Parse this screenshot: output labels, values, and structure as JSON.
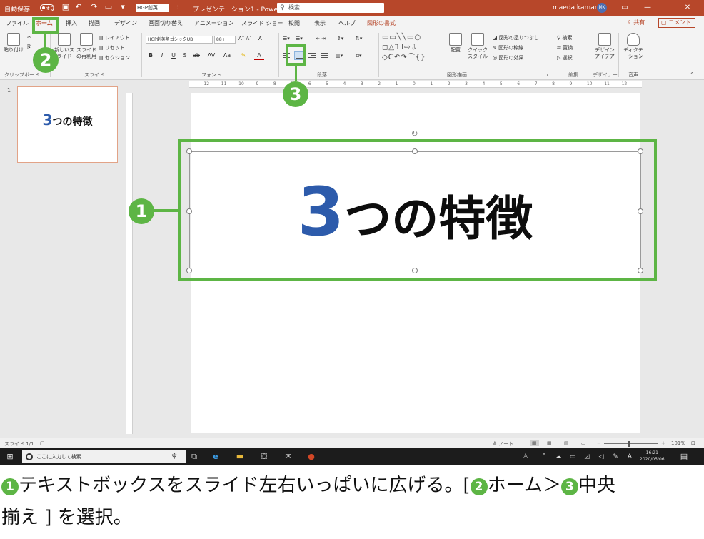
{
  "titlebar": {
    "autosave": "自動保存",
    "autosave_state": "オフ",
    "font_chip": "HGP創英",
    "doc_title": "プレゼンテーション1 - PowerPoint",
    "search_placeholder": "検索",
    "user_name": "maeda kamari",
    "user_initials": "MK"
  },
  "tabs": [
    "ファイル",
    "ホーム",
    "挿入",
    "描画",
    "デザイン",
    "画面切り替え",
    "アニメーション",
    "スライド ショー",
    "校閲",
    "表示",
    "ヘルプ",
    "図形の書式"
  ],
  "share_label": "共有",
  "comment_label": "コメント",
  "ribbon": {
    "clipboard_label": "クリップボード",
    "paste_label": "貼り付け",
    "slide_group_label": "スライド",
    "new_slide_label": "新しいスライド",
    "reuse_slide_label": "スライドの再利用",
    "layout_label": "レイアウト",
    "reset_label": "リセット",
    "section_label": "セクション",
    "font_group_label": "フォント",
    "font_name": "HGP創英角ゴシックUB",
    "font_size": "88+",
    "paragraph_label": "段落",
    "drawing_label": "図形描画",
    "arrange_label": "配置",
    "quick_style_label": "クイック スタイル",
    "shape_fill_label": "図形の塗りつぶし",
    "shape_outline_label": "図形の枠線",
    "shape_effect_label": "図形の効果",
    "editing_label": "編集",
    "find_label": "検索",
    "replace_label": "置換",
    "select_label": "選択",
    "designer_label": "デザイナー",
    "design_ideas_label": "デザイン アイデア",
    "voice_label": "音声",
    "dictate_label": "ディクテーション"
  },
  "ruler_numbers": [
    "12",
    "11",
    "10",
    "9",
    "8",
    "7",
    "6",
    "5",
    "4",
    "3",
    "2",
    "1",
    "0",
    "1",
    "2",
    "3",
    "4",
    "5",
    "6",
    "7",
    "8",
    "9",
    "10",
    "11",
    "12"
  ],
  "thumbnail": {
    "number": "1",
    "title_num": "3",
    "title_rest": "つの特徴"
  },
  "slide": {
    "title_num": "3",
    "title_rest": "つの特徴"
  },
  "statusbar": {
    "slide_count": "スライド 1/1",
    "notes": "ノート",
    "zoom": "101%"
  },
  "taskbar": {
    "search_placeholder": "ここに入力して検索",
    "time": "16:21",
    "date": "2020/05/06"
  },
  "callouts": {
    "one": "1",
    "two": "2",
    "three": "3"
  },
  "caption": {
    "line1_a": "テキストボックスをスライド左右いっぱいに広げる。[",
    "line1_b": "ホーム＞",
    "line1_c": "中央",
    "line2": "揃え ] を選択。"
  },
  "colors": {
    "accent": "#b7472a",
    "callout": "#5db545",
    "title_number": "#2d5bab"
  }
}
